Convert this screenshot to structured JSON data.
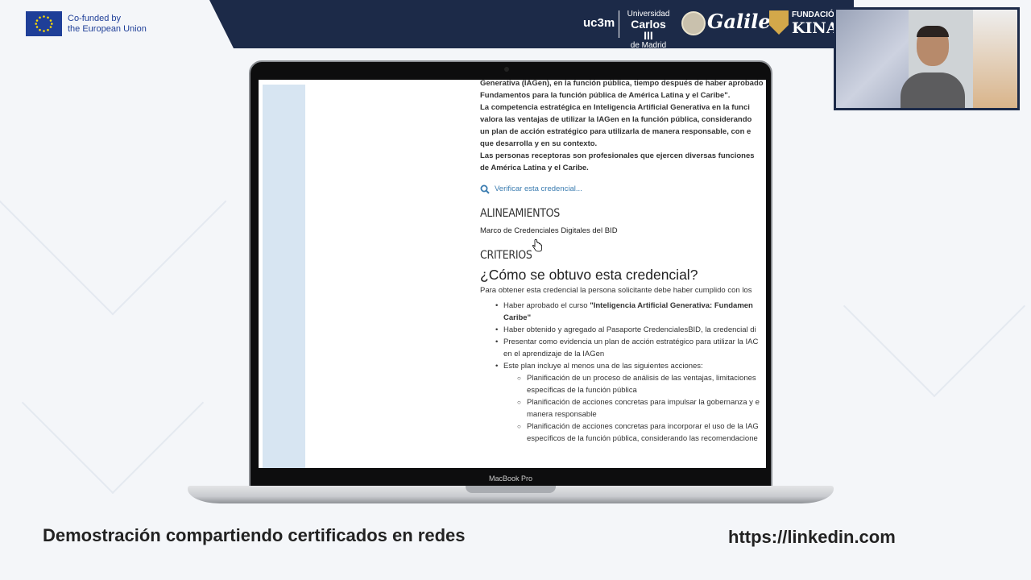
{
  "header": {
    "eu_line1": "Co-funded by",
    "eu_line2": "the European Union",
    "uc3m": "uc3m",
    "uc3m_line1": "Universidad",
    "uc3m_line2": "Carlos III",
    "uc3m_line3": "de Madrid",
    "galileo": "Galileo",
    "kinal_line1": "FUNDACIÓ",
    "kinal_line2": "KINAL"
  },
  "credential_page": {
    "intro_lines": [
      "Generativa (IAGen), en la función pública, tiempo después de haber aprobado",
      "Fundamentos para la función pública de América Latina y el Caribe\".",
      "La competencia estratégica en Inteligencia Artificial Generativa en la funci",
      "valora las ventajas de utilizar la IAGen en la función pública, considerando",
      "un plan de acción estratégico para utilizarla de manera responsable, con e",
      "que desarrolla y en su contexto.",
      "Las personas receptoras son profesionales que ejercen diversas funciones",
      "de América Latina y el Caribe."
    ],
    "verify_link": "Verificar esta credencial...",
    "alignments_heading": "ALINEAMIENTOS",
    "alignment_link": "Marco de Credenciales Digitales del BID",
    "criteria_heading": "CRITERIOS",
    "how_heading": "¿Cómo se obtuvo esta credencial?",
    "lead_text": "Para obtener esta credencial la persona solicitante debe haber cumplido con los",
    "bullets": {
      "b1_prefix": "Haber aprobado el curso ",
      "b1_bold": "\"Inteligencia Artificial Generativa: Fundamen",
      "b1_cont": "Caribe\"",
      "b2": "Haber obtenido y agregado al Pasaporte CredencialesBID, la credencial di",
      "b3_l1": "Presentar como evidencia un plan de acción estratégico para utilizar la IAC",
      "b3_l2": "en el aprendizaje de la IAGen",
      "b4": "Este plan incluye al menos una de las siguientes acciones:"
    },
    "sub_bullets": [
      [
        "Planificación de un proceso de análisis de las ventajas, limitaciones",
        "específicas de la función pública"
      ],
      [
        "Planificación de acciones concretas para impulsar la gobernanza y e",
        "manera responsable"
      ],
      [
        "Planificación de acciones concretas para incorporar el uso de la IAG",
        "específicos de la función pública, considerando las recomendacione"
      ]
    ]
  },
  "laptop_label": "MacBook Pro",
  "caption": "Demostración compartiendo certificados en redes",
  "url": "https://linkedin.com",
  "colors": {
    "header_navy": "#1c2a48",
    "eu_blue": "#1f3f98",
    "link_blue": "#3a7cb0"
  }
}
